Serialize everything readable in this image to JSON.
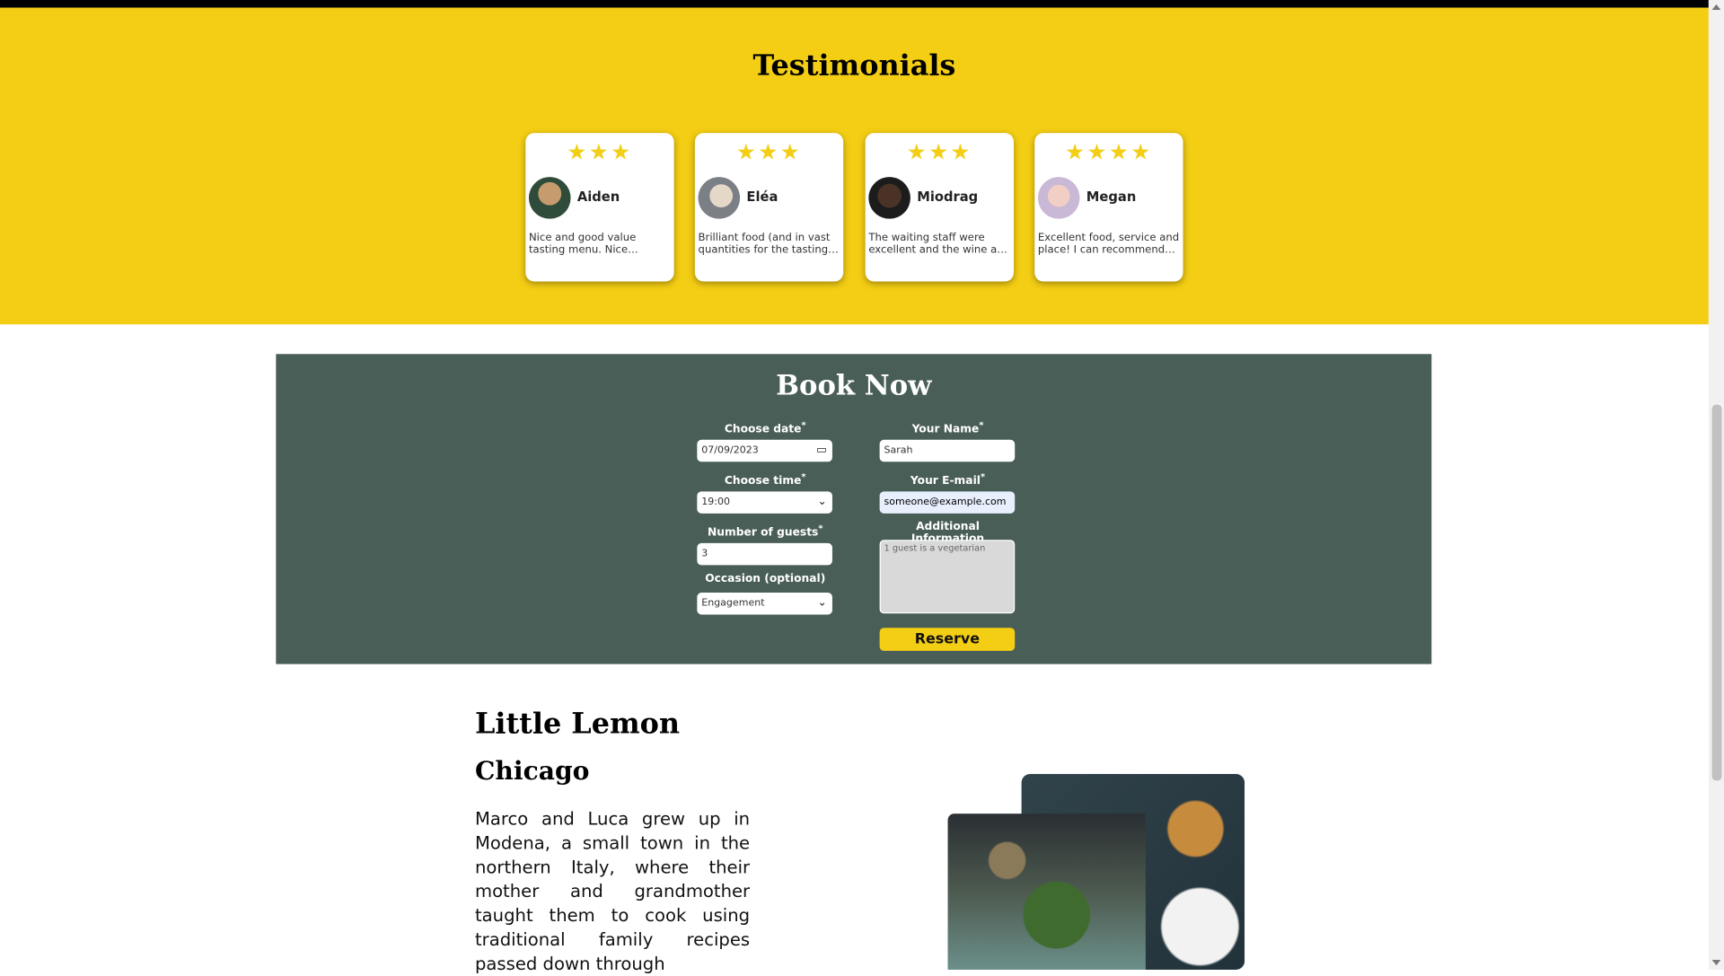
{
  "testimonials": {
    "title": "Testimonials",
    "cards": [
      {
        "name": "Aiden",
        "stars": 3,
        "text": "Nice and good value tasting menu. Nice ambience, good service"
      },
      {
        "name": "Eléa",
        "stars": 3,
        "text": "Brilliant food (and in vast quantities for the tasting menu)"
      },
      {
        "name": "Miodrag",
        "stars": 3,
        "text": "The waiting staff were excellent and the wine and food"
      },
      {
        "name": "Megan",
        "stars": 4,
        "text": "Excellent food, service and place! I can recommend this"
      }
    ]
  },
  "booking": {
    "title": "Book Now",
    "date_label": "Choose date",
    "date_value": "07/09/2023",
    "time_label": "Choose time",
    "time_value": "19:00",
    "guests_label": "Number of guests",
    "guests_value": "3",
    "occasion_label": "Occasion (optional)",
    "occasion_value": "Engagement",
    "name_label": "Your Name",
    "name_value": "Sarah",
    "email_label": "Your E-mail",
    "email_value": "someone@example.com",
    "info_label": "Additional Information",
    "info_value": "1 guest is a vegetarian",
    "required_mark": "*",
    "reserve_label": "Reserve"
  },
  "about": {
    "title": "Little Lemon",
    "subtitle": "Chicago",
    "paragraph": "Marco and Luca grew up in Modena, a small town in the northern Italy, where their mother and grandmother taught them to cook using traditional family recipes passed down through"
  },
  "colors": {
    "yellow": "#f4ce14",
    "green": "#495e57"
  }
}
